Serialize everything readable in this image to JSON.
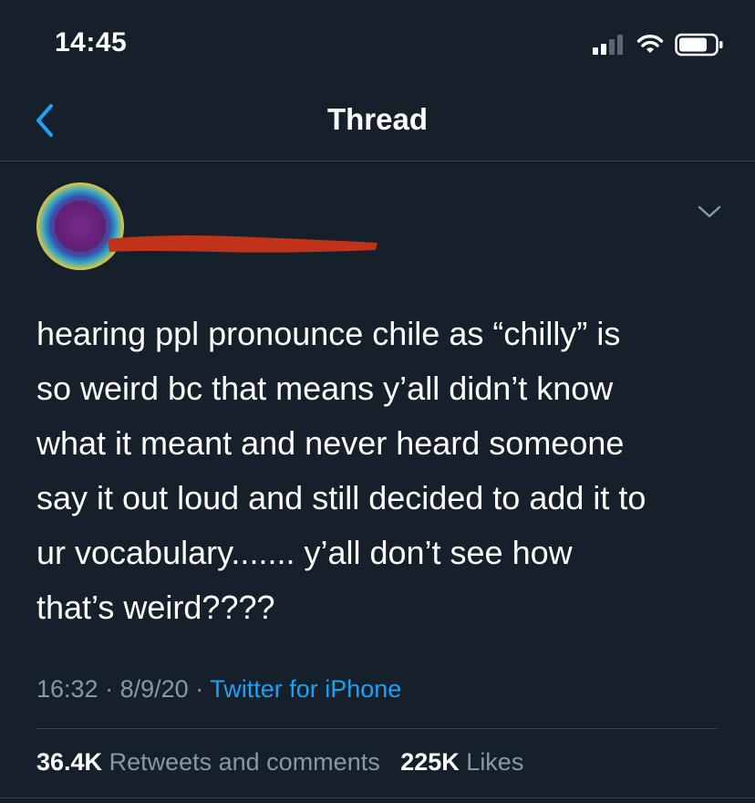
{
  "status_bar": {
    "time": "14:45"
  },
  "nav": {
    "title": "Thread"
  },
  "tweet": {
    "text": "hearing ppl pronounce chile as “chilly” is\nso weird bc that means y’all didn’t know\nwhat it meant and never heard someone\nsay it out loud and still decided to add it to\nur vocabulary....... y’all don’t see how\nthat’s weird????",
    "time": "16:32",
    "separator": "·",
    "date": "8/9/20",
    "source": "Twitter for iPhone",
    "retweets_count": "36.4K",
    "retweets_label": "Retweets and comments",
    "likes_count": "225K",
    "likes_label": "Likes"
  },
  "colors": {
    "background": "#15202b",
    "accent": "#1da1f2",
    "muted": "#8899a6",
    "redaction": "#c0321a"
  },
  "icons": [
    "back-chevron-icon",
    "signal-icon",
    "wifi-icon",
    "battery-icon",
    "chevron-down-icon"
  ]
}
